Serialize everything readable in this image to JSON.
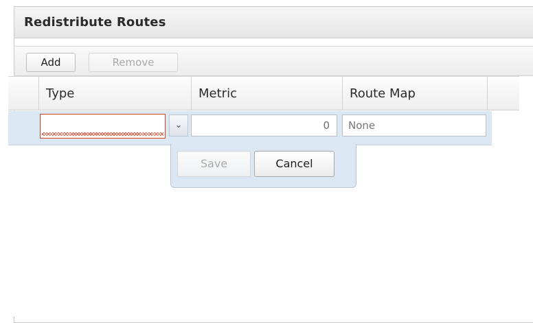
{
  "panel": {
    "title": "Redistribute Routes"
  },
  "toolbar": {
    "add_label": "Add",
    "remove_label": "Remove"
  },
  "grid": {
    "columns": [
      "Type",
      "Metric",
      "Route Map"
    ],
    "editor": {
      "type_value": "",
      "metric_value": "0",
      "route_map_value": "None",
      "save_label": "Save",
      "cancel_label": "Cancel"
    }
  },
  "icons": {
    "combo_trigger": "chevron-down-icon"
  },
  "colors": {
    "invalid_border": "#d1401c",
    "editor_row_bg": "#dbe7f3"
  }
}
